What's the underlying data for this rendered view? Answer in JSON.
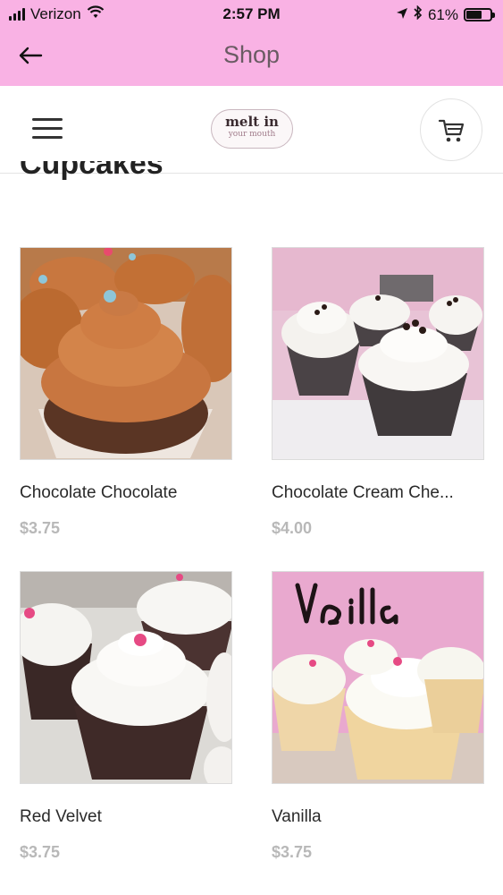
{
  "status_bar": {
    "carrier": "Verizon",
    "time": "2:57 PM",
    "battery": "61%"
  },
  "nav": {
    "title": "Shop"
  },
  "store_header": {
    "logo_main": "melt in",
    "logo_sub": "your mouth"
  },
  "section": {
    "title": "Cupcakes"
  },
  "products": [
    {
      "name": "Chocolate Chocolate",
      "price": "$3.75"
    },
    {
      "name": "Chocolate Cream Che...",
      "price": "$4.00"
    },
    {
      "name": "Red Velvet",
      "price": "$3.75"
    },
    {
      "name": "Vanilla",
      "price": "$3.75"
    }
  ],
  "colors": {
    "header_pink": "#f9b2e4",
    "price_gray": "#b8b8b8"
  },
  "icons": [
    "signal-icon",
    "wifi-icon",
    "location-arrow-icon",
    "bluetooth-icon",
    "battery-icon",
    "back-arrow-icon",
    "menu-icon",
    "cart-icon"
  ]
}
